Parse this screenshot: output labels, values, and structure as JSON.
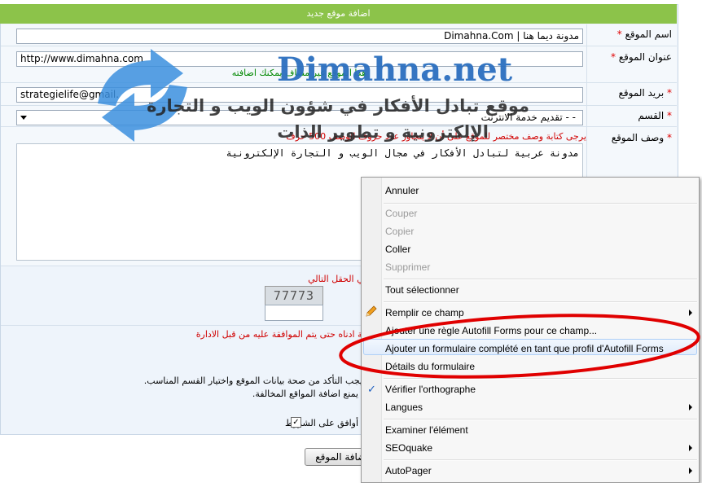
{
  "form": {
    "header": "اضافة موقع جديد",
    "site_name_label": "اسم الموقع",
    "site_name_value": "مدونة ديما هنا  |  Dimahna.Com",
    "site_url_label": "عنوان الموقع",
    "site_url_value": "http://www.dimahna.com",
    "site_url_note": "هذا الموقع غير مضاف يمكنك اضافته",
    "email_label": "بريد الموقع",
    "email_value": "strategielife@gmail.",
    "category_label": "القسم",
    "category_value": "-  - تقديم خدمة الانترنت",
    "desc_label": "وصف الموقع",
    "desc_note": "يرجى كتابة وصف مختصر للموقع على أن لا يتجاوز عدد حروف الوصف 500 حرف",
    "desc_value": "مدونة عربية لتبادل الأفكار في مجال الويب و التجارة الإلكترونية",
    "captcha_note": "يرجى كتابة الرقم الموضح كما في الصورة في الحقل التالي",
    "captcha_code": "77773",
    "approval_note": "سوف تتم مراجعة البيانات الموضحة ادناه حتى يتم الموافقة عليه من قبل الادارة",
    "terms_line1": "يجب التأكد من صحة بيانات الموقع واختيار القسم المناسب.",
    "terms_line2": "يمنع اضافة المواقع المخالفة.",
    "agree_label": "أوافق على الشروط",
    "submit_label": "اضافة الموقع",
    "star": "*"
  },
  "watermark": {
    "title": "Dimahna.net",
    "line1": "موقع تبادل الأفكار في شؤون الويب و التجارة",
    "line2": "الإلكترونية و تطوير الذات",
    "icon": "refresh-arrows-icon",
    "color": "#2b6fbf"
  },
  "context_menu": {
    "items": [
      {
        "label": "Annuler",
        "disabled": false
      },
      {
        "label": "Couper",
        "disabled": true
      },
      {
        "label": "Copier",
        "disabled": true
      },
      {
        "label": "Coller",
        "disabled": false
      },
      {
        "label": "Supprimer",
        "disabled": true
      },
      {
        "label": "Tout sélectionner",
        "disabled": false
      },
      {
        "label": "Remplir ce champ",
        "disabled": false,
        "icon": "pencil-icon",
        "submenu": true
      },
      {
        "label": "Ajouter une règle Autofill Forms pour ce champ...",
        "disabled": false
      },
      {
        "label": "Ajouter un formulaire complété en tant que profil d'Autofill Forms",
        "disabled": false,
        "highlighted": true
      },
      {
        "label": "Détails du formulaire",
        "disabled": false
      },
      {
        "label": "Vérifier l'orthographe",
        "disabled": false,
        "icon": "checkmark-icon",
        "checked": true
      },
      {
        "label": "Langues",
        "disabled": false,
        "submenu": true
      },
      {
        "label": "Examiner l'élément",
        "disabled": false
      },
      {
        "label": "SEOquake",
        "disabled": false,
        "submenu": true
      },
      {
        "label": "AutoPager",
        "disabled": false,
        "submenu": true
      }
    ],
    "annotation_color": "#e00000"
  }
}
